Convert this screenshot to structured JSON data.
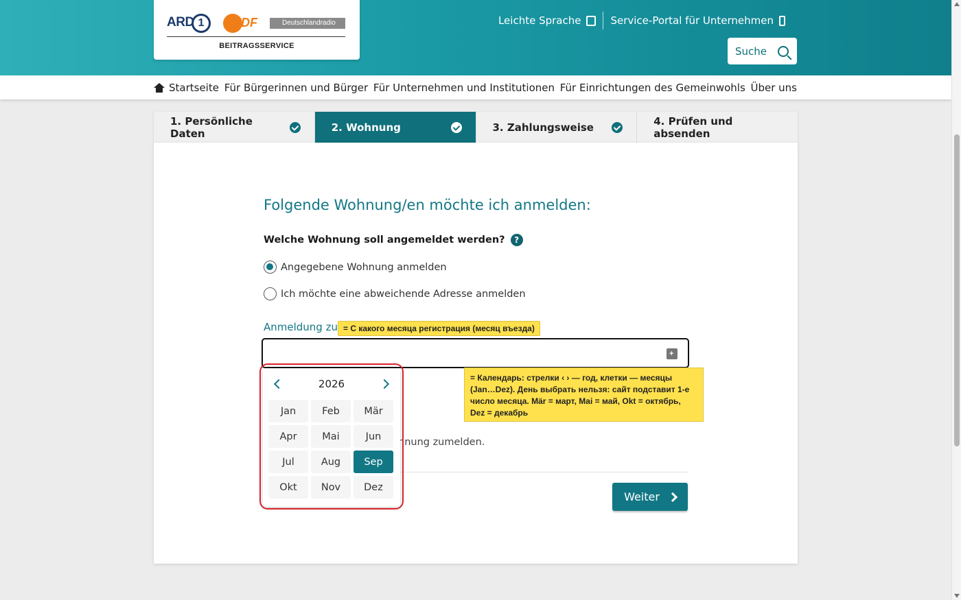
{
  "logo": {
    "ard": "ARD",
    "ard_one": "1",
    "zdf": "ZDF",
    "deutschlandradio": "Deutschlandradio",
    "beitragsservice": "BEITRAGSSERVICE"
  },
  "toplinks": {
    "easy_language": "Leichte Sprache",
    "business_portal": "Service-Portal für Unternehmen"
  },
  "search": {
    "label": "Suche"
  },
  "nav": {
    "home": "Startseite",
    "citizens": "Für Bürgerinnen und Bürger",
    "companies": "Für Unternehmen und Institutionen",
    "nonprofit": "Für Einrichtungen des Gemeinwohls",
    "about": "Über uns"
  },
  "steps": [
    {
      "label": "1. Persönliche Daten",
      "done": true
    },
    {
      "label": "2. Wohnung",
      "done": true,
      "active": true
    },
    {
      "label": "3. Zahlungsweise",
      "done": true
    },
    {
      "label": "4. Prüfen und absenden",
      "done": false
    }
  ],
  "form": {
    "heading": "Folgende Wohnung/en möchte ich anmelden:",
    "question": "Welche Wohnung soll angemeldet werden?",
    "help": "?",
    "option1": "Angegebene Wohnung anmelden",
    "option2": "Ich möchte eine abweichende Adresse anmelden",
    "selected_option": 1,
    "date_label": "Anmeldung zu",
    "date_value": "",
    "hint_partial": "hnung zumelden.",
    "next_button": "Weiter"
  },
  "picker": {
    "year": "2026",
    "months": [
      "Jan",
      "Feb",
      "Mär",
      "Apr",
      "Mai",
      "Jun",
      "Jul",
      "Aug",
      "Sep",
      "Okt",
      "Nov",
      "Dez"
    ],
    "selected": "Sep"
  },
  "annotations": {
    "note1": "= С какого месяца регистрация (месяц въезда)",
    "note2": "= Календарь: стрелки ‹ › — год, клетки — месяцы (Jan…Dez). День выбрать нельзя: сайт подставит 1-е число месяца. Mär = март, Mai = май, Okt = октябрь, Dez = декабрь"
  },
  "colors": {
    "primary": "#127785",
    "header_start": "#2fb0b8",
    "header_end": "#0f7f8c",
    "annotation": "#ffe14d",
    "highlight_outline": "#d8232a"
  }
}
